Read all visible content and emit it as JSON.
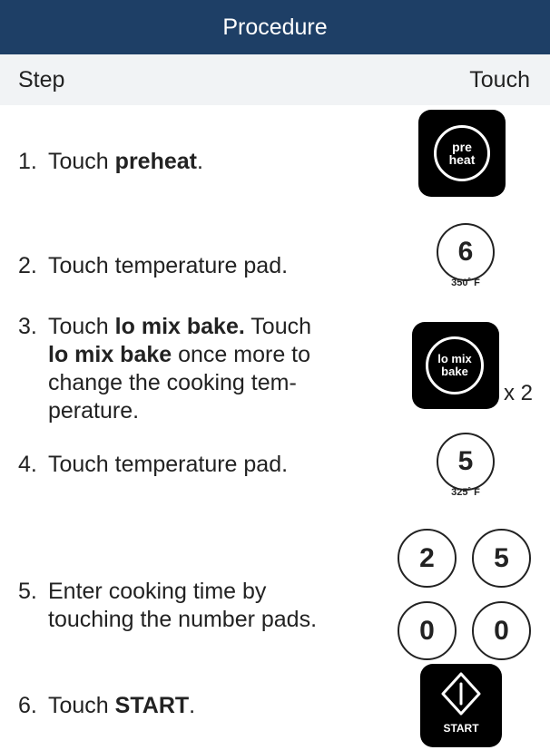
{
  "header": {
    "title": "Procedure"
  },
  "columns": {
    "step": "Step",
    "touch": "Touch"
  },
  "steps": [
    {
      "num": "1.",
      "text_a": "Touch ",
      "bold_a": "preheat",
      "text_b": "."
    },
    {
      "num": "2.",
      "text_a": "Touch temperature pad."
    },
    {
      "num": "3.",
      "text_a": "Touch ",
      "bold_a": "lo mix bake.",
      "text_b": " Touch ",
      "bold_b": "lo mix bake",
      "text_c": " once more to change the cooking tem-perature."
    },
    {
      "num": "4.",
      "text_a": "Touch temperature pad."
    },
    {
      "num": "5.",
      "text_a": "Enter cooking time by touching the number pads."
    },
    {
      "num": "6.",
      "text_a": "Touch ",
      "bold_a": "START",
      "text_b": "."
    }
  ],
  "keys": {
    "preheat": {
      "line1": "pre",
      "line2": "heat",
      "icon": "preheat-key-icon"
    },
    "temp1": {
      "digit": "6",
      "temp": "350˚ F"
    },
    "lomix": {
      "line1": "lo mix",
      "line2": "bake",
      "times": "x 2",
      "icon": "lo-mix-bake-key-icon"
    },
    "temp2": {
      "digit": "5",
      "temp": "325˚ F"
    },
    "time_pads": [
      "2",
      "5",
      "0",
      "0"
    ],
    "start": {
      "label": "START",
      "icon": "start-diamond-icon"
    }
  },
  "colors": {
    "header_bg": "#1e3f66",
    "subheader_bg": "#f1f3f5",
    "key_bg": "#000000"
  }
}
